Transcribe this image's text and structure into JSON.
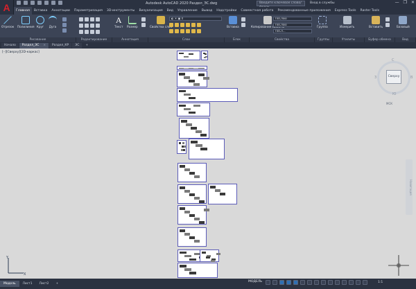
{
  "app": {
    "logo": "A",
    "title": "Autodesk AutoCAD 2020    Раздел_ЭС.dwg"
  },
  "search": {
    "placeholder": "Введите ключевое слово/фразу"
  },
  "signin": {
    "label": "Вход в службы"
  },
  "ribbon_tabs": [
    "Главная",
    "Вставка",
    "Аннотации",
    "Параметризация",
    "3D-инструменты",
    "Визуализация",
    "Вид",
    "Управление",
    "Вывод",
    "Надстройки",
    "Совместная работа",
    "Рекомендованные приложения",
    "Express Tools",
    "Raster Tools"
  ],
  "ribbon": {
    "draw": {
      "label": "Рисование",
      "line": "Отрезок",
      "polyline": "Полилиния",
      "circle": "Круг",
      "arc": "Дуга"
    },
    "modify": {
      "label": "Редактирование"
    },
    "annotation": {
      "label": "Аннотация",
      "text": "Текст",
      "dimension": "Размер"
    },
    "layers": {
      "label": "Слои",
      "properties": "Свойства слоя"
    },
    "block": {
      "label": "Блок",
      "insert": "Вставка"
    },
    "properties": {
      "label": "Свойства",
      "copy": "Копирование свойств",
      "bylayer1": "ПоСлою",
      "bylayer2": "ПоСлою",
      "bylayer3": "ПоСл..."
    },
    "groups": {
      "label": "Группы",
      "group": "Группа"
    },
    "utilities": {
      "label": "Утилиты",
      "measure": "Измерить"
    },
    "clipboard": {
      "label": "Буфер обмена",
      "paste": "Вставить"
    },
    "view": {
      "label": "Вид",
      "base": "Базовый"
    }
  },
  "doc_tabs": [
    {
      "label": "Начало"
    },
    {
      "label": "Раздел_ЭС",
      "close": "×"
    },
    {
      "label": "Раздел_КР"
    },
    {
      "label": "ЭС"
    }
  ],
  "canvas": {
    "view_label": "[–][Сверху][2D-каркас]"
  },
  "viewcube": {
    "top_label": "Сверху",
    "north": "С",
    "south": "Ю",
    "west": "З",
    "east": "В",
    "ucs": "МСК"
  },
  "navbar": {
    "label": "Навигация"
  },
  "layout_tabs": [
    "Модель",
    "Лист1",
    "Лист2"
  ],
  "status": {
    "model": "МОДЕЛЬ",
    "scale": "1:1"
  },
  "colors": {
    "bg": "#d9d9d9",
    "dark": "#2b3241",
    "ribbon": "#3c4456",
    "sheet_border": "#5a5ab8"
  }
}
